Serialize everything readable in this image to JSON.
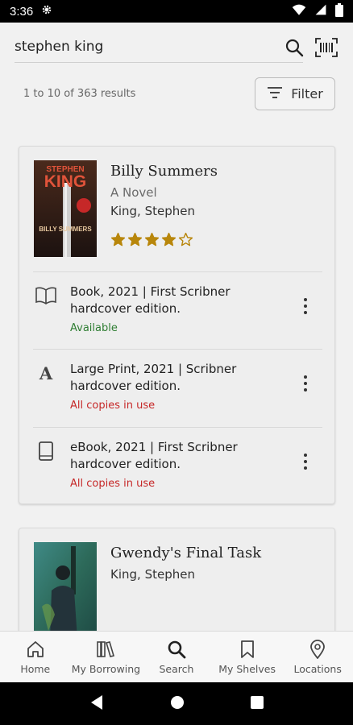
{
  "status_bar": {
    "time": "3:36"
  },
  "search": {
    "query": "stephen king"
  },
  "results": {
    "count_text": "1 to 10 of 363 results",
    "filter_label": "Filter"
  },
  "books": [
    {
      "title": "Billy Summers",
      "subtitle": "A Novel",
      "author": "King, Stephen",
      "rating": 4,
      "rating_max": 5,
      "cover_text_top": "STEPHEN",
      "cover_text_mid": "KING",
      "cover_text_bottom": "BILLY SUMMERS",
      "formats": [
        {
          "icon": "book-open-icon",
          "line1": "Book, 2021 | First Scribner",
          "line2": "hardcover edition.",
          "status": "Available",
          "status_color": "#2e7d32"
        },
        {
          "icon": "large-print-icon",
          "line1": "Large Print, 2021 | Scribner",
          "line2": "hardcover edition.",
          "status": "All copies in use",
          "status_color": "#c62828"
        },
        {
          "icon": "tablet-icon",
          "line1": "eBook, 2021 | First Scribner",
          "line2": "hardcover edition.",
          "status": "All copies in use",
          "status_color": "#c62828"
        }
      ]
    },
    {
      "title": "Gwendy's Final Task",
      "author": "King, Stephen"
    }
  ],
  "bottom_nav": [
    {
      "label": "Home",
      "icon": "home-icon"
    },
    {
      "label": "My Borrowing",
      "icon": "books-icon"
    },
    {
      "label": "Search",
      "icon": "search-icon"
    },
    {
      "label": "My Shelves",
      "icon": "bookmark-icon"
    },
    {
      "label": "Locations",
      "icon": "location-pin-icon"
    }
  ],
  "colors": {
    "star": "#b8860b",
    "available": "#2e7d32",
    "unavailable": "#c62828"
  }
}
